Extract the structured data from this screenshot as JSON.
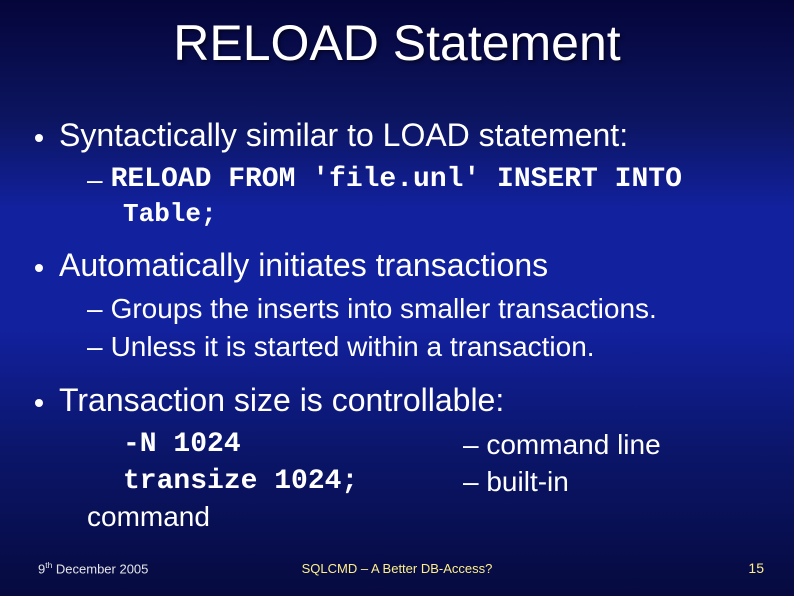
{
  "title": "RELOAD Statement",
  "bullets": {
    "b1": "Syntactically similar to LOAD statement:",
    "b1_sub_dash": "–",
    "b1_code1": "RELOAD FROM 'file.unl' INSERT INTO",
    "b1_code2": "Table;",
    "b2": "Automatically initiates transactions",
    "b2_sub1_dash": "–",
    "b2_sub1": "Groups the inserts into smaller transactions.",
    "b2_sub2_dash": "–",
    "b2_sub2": "Unless it is started within a transaction.",
    "b3": "Transaction size is controllable:",
    "tc_left1": "-N 1024",
    "tc_left2": "transize 1024;",
    "tc_right1_dash": "–",
    "tc_right1": "command line",
    "tc_right2_dash": "–",
    "tc_right2": "built-in",
    "tc_left3": "command"
  },
  "footer": {
    "date_pre": "9",
    "date_sup": "th",
    "date_post": " December 2005",
    "center": "SQLCMD – A Better DB-Access?",
    "page": "15"
  }
}
